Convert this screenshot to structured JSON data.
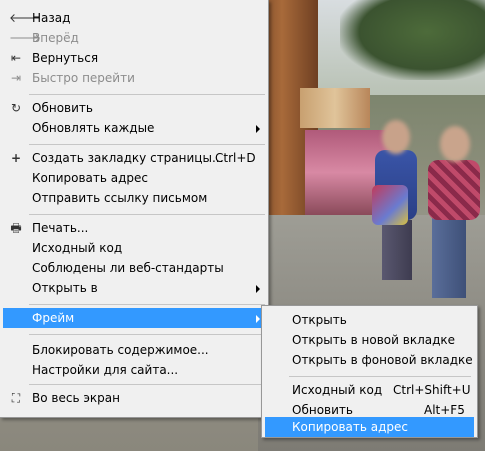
{
  "context_menu": {
    "items": {
      "back": "Назад",
      "forward": "Вперёд",
      "rewind": "Вернуться",
      "fast_forward": "Быстро перейти",
      "reload": "Обновить",
      "reload_every": "Обновлять каждые",
      "bookmark": "Создать закладку страницы...",
      "bookmark_shortcut": "Ctrl+D",
      "copy_address": "Копировать адрес",
      "send_link": "Отправить ссылку письмом",
      "print": "Печать...",
      "source": "Исходный код",
      "validate": "Соблюдены ли веб-стандарты",
      "open_in": "Открыть в",
      "frame": "Фрейм",
      "block_content": "Блокировать содержимое...",
      "site_prefs": "Настройки для сайта...",
      "fullscreen": "Во весь экран"
    }
  },
  "frame_submenu": {
    "items": {
      "open": "Открыть",
      "open_new_tab": "Открыть в новой вкладке",
      "open_bg_tab": "Открыть в фоновой вкладке",
      "source": "Исходный код",
      "source_shortcut": "Ctrl+Shift+U",
      "reload": "Обновить",
      "reload_shortcut": "Alt+F5",
      "copy_address": "Копировать адрес"
    }
  },
  "icons": {
    "back": "arrow-left",
    "forward": "arrow-right",
    "rewind": "rewind",
    "fast_forward": "fast-forward",
    "reload": "reload",
    "bookmark": "plus",
    "print": "printer",
    "fullscreen": "fullscreen"
  },
  "colors": {
    "highlight": "#3399ff",
    "menu_bg": "#f0f0f0",
    "disabled_text": "#8c8c8c"
  }
}
